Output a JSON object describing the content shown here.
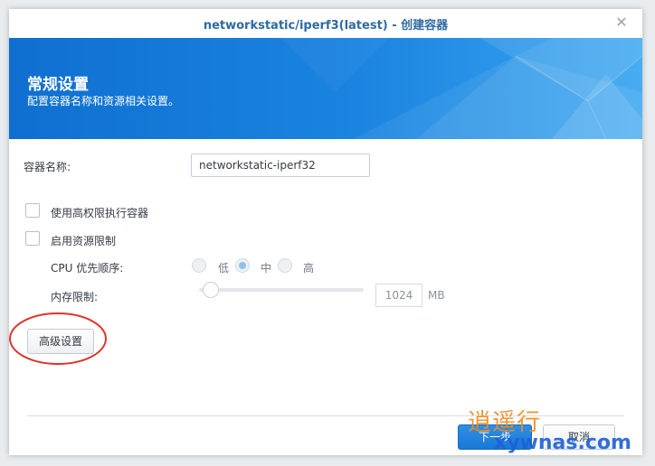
{
  "window": {
    "title": "networkstatic/iperf3(latest) - 创建容器",
    "close_glyph": "✕"
  },
  "banner": {
    "title": "常规设置",
    "subtitle": "配置容器名称和资源相关设置。"
  },
  "form": {
    "container_name_label": "容器名称:",
    "container_name_value": "networkstatic-iperf32",
    "privileged_label": "使用高权限执行容器",
    "privileged_checked": false,
    "resource_limit_label": "启用资源限制",
    "resource_limit_checked": false,
    "cpu_priority_label": "CPU 优先顺序:",
    "cpu_options": [
      {
        "label": "低",
        "selected": false
      },
      {
        "label": "中",
        "selected": true
      },
      {
        "label": "高",
        "selected": false
      }
    ],
    "memory_label": "内存限制:",
    "memory_value": "1024",
    "memory_unit": "MB",
    "memory_slider_fraction": 0.07
  },
  "buttons": {
    "advanced": "高级设置",
    "next": "下一步",
    "cancel": "取消"
  },
  "watermark": {
    "top": "逍遥行",
    "bottom": "xywnas.com"
  },
  "colors": {
    "title": "#2d6aa1",
    "banner": "#1a84e0",
    "primary_button": "#1a78d6",
    "annotation_circle": "#e0322a",
    "watermark_top": "#f08a1e",
    "watermark_bottom": "#1d5fd6"
  }
}
